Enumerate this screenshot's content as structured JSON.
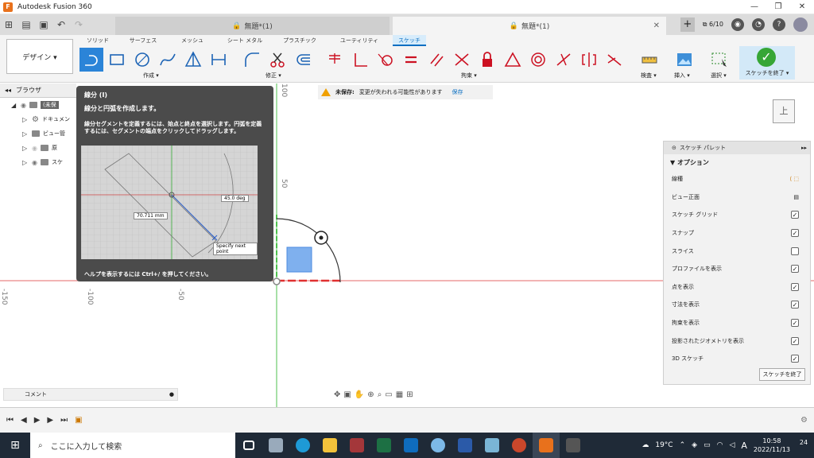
{
  "window": {
    "app_title": "Autodesk Fusion 360",
    "logo_letter": "F",
    "controls": [
      "—",
      "❐",
      "✕"
    ]
  },
  "tabs": {
    "inactive": "無題*(1)",
    "active": "無題*(1)",
    "job_count": "6/10"
  },
  "ribbon": {
    "workspace": "デザイン ▾",
    "tabs": [
      "ソリッド",
      "サーフェス",
      "メッシュ",
      "シート メタル",
      "プラスチック",
      "ユーティリティ",
      "スケッチ"
    ],
    "active_tab": "スケッチ",
    "groups": {
      "create": "作成 ▾",
      "modify": "修正 ▾",
      "constraints": "拘束 ▾",
      "inspect": "検査 ▾",
      "insert": "挿入 ▾",
      "select": "選択 ▾",
      "finish": "スケッチを終了 ▾"
    }
  },
  "browser": {
    "title": "ブラウザ",
    "items": [
      "(未保",
      "ドキュメン",
      "ビュー管",
      "原",
      "スケ"
    ]
  },
  "tooltip": {
    "title": "線分 (I)",
    "subtitle": "線分と円弧を作成します。",
    "description": "線分セグメントを定義するには、始点と終点を選択します。円弧を定義するには、セグメントの端点をクリックしてドラッグします。",
    "footer": "ヘルプを表示するには Ctrl+/ を押してください。",
    "image": {
      "length_label": "70.711 mm",
      "angle_label": "45.0 deg",
      "prompt": "Specify next point"
    }
  },
  "banner": {
    "label": "未保存:",
    "message": "変更が失われる可能性があります",
    "action": "保存"
  },
  "canvas": {
    "ruler_top": [
      "100",
      "50"
    ],
    "ruler_left": [
      "-150",
      "-100",
      "-50"
    ]
  },
  "viewcube": {
    "face": "上"
  },
  "palette": {
    "title": "スケッチ パレット",
    "section": "オプション",
    "rows": [
      {
        "label": "線種",
        "type": "icons"
      },
      {
        "label": "ビュー正面",
        "type": "icon"
      },
      {
        "label": "スケッチ グリッド",
        "checked": true
      },
      {
        "label": "スナップ",
        "checked": true
      },
      {
        "label": "スライス",
        "checked": false
      },
      {
        "label": "プロファイルを表示",
        "checked": true
      },
      {
        "label": "点を表示",
        "checked": true
      },
      {
        "label": "寸法を表示",
        "checked": true
      },
      {
        "label": "拘束を表示",
        "checked": true
      },
      {
        "label": "投影されたジオメトリを表示",
        "checked": true
      },
      {
        "label": "3D スケッチ",
        "checked": true
      }
    ],
    "finish_button": "スケッチを終了"
  },
  "comments": {
    "label": "コメント"
  },
  "taskbar": {
    "search_placeholder": "ここに入力して検索",
    "weather": "19°C",
    "ime": "A",
    "time": "10:58",
    "date": "2022/11/13",
    "notifications": "24"
  }
}
